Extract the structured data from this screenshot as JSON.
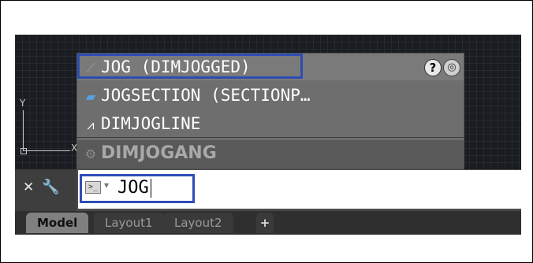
{
  "autocomplete": {
    "items": [
      {
        "label": "JOG (DIMJOGGED)",
        "icon": "jogged-dimension-icon"
      },
      {
        "label": "JOGSECTION (SECTIONP…",
        "icon": "section-plane-icon"
      },
      {
        "label": "DIMJOGLINE",
        "icon": "jog-line-icon"
      },
      {
        "label": "DIMJOGANG",
        "icon": "gear-icon"
      }
    ],
    "help_icon_label": "?"
  },
  "ucs": {
    "y_label": "Y",
    "x_label": "X"
  },
  "command_line": {
    "value": "JOG",
    "prompt_arrow": "▾"
  },
  "tabs": [
    {
      "label": "Model",
      "active": true
    },
    {
      "label": "Layout1",
      "active": false
    },
    {
      "label": "Layout2",
      "active": false
    },
    {
      "label": "+",
      "active": false
    }
  ],
  "colors": {
    "highlight": "#2e4db3",
    "canvas": "#191c20"
  }
}
